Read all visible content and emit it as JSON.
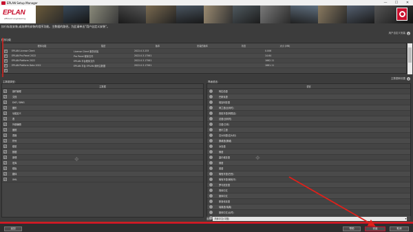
{
  "window": {
    "title": "EPLAN Setup Manager",
    "minimize": "—",
    "maximize": "☐",
    "close": "✕"
  },
  "banner": {
    "logo_text": "EPLAN",
    "logo_sub": "efficient engineering."
  },
  "instruction": "执行标准安装,或选择所安装的程序功能。主数据的路径。为此请单击\"用户自定义安装\"。",
  "custom_install_label": "用户自定义安装",
  "program_section": {
    "label": "程序功能",
    "columns": [
      "程序功能",
      "描述",
      "版本",
      "安装的版本",
      "状态",
      "大小 (MB)"
    ],
    "rows": [
      {
        "checked": true,
        "name": "EPLAN License Client",
        "desc": "License Client 服务安装",
        "version": "2022.0.3.233",
        "installed": "",
        "status": "",
        "size": "0.006"
      },
      {
        "checked": true,
        "name": "EPLAN Pro Panel 2022",
        "desc": "Pro Panel 程序文件",
        "version": "2022.0.3.17561",
        "installed": "",
        "status": "",
        "size": "14.64"
      },
      {
        "checked": true,
        "name": "EPLAN Platform 2022",
        "desc": "EPLAN 平台程序文件",
        "version": "2022.0.3.17561",
        "installed": "",
        "status": "",
        "size": "1662.11"
      },
      {
        "checked": true,
        "name": "EPLAN Platform Data 2022",
        "desc": "EPLAN 平台 EPLAN 用例主数据",
        "version": "2022.0.3.17561",
        "installed": "",
        "status": "",
        "size": "1661.11"
      },
      {
        "checked": true,
        "name": "",
        "desc": "",
        "version": "",
        "installed": "",
        "status": "",
        "size": ""
      }
    ]
  },
  "masterdata_expand_label": "主数据和设置",
  "master_data": {
    "caption": "主数据类型:",
    "column": "主数据",
    "items": [
      "部件管理",
      "文档",
      "DXF / DWG",
      "图形",
      "功能定义",
      "表",
      "外部编辑",
      "图框",
      "表格",
      "符号",
      "模型",
      "数据",
      "原理",
      "宏库",
      "模板",
      "翻译",
      "XML"
    ]
  },
  "interface_language": {
    "caption": "界面语言:",
    "column": "语言",
    "items": [
      "阿拉伯语",
      "巴斯克语",
      "保加利亚语",
      "荷兰语(比利时)",
      "西班牙语(阿根廷)",
      "法语(比利时)",
      "日语(日本)",
      "爱尔兰语",
      "意大利语(意大利)",
      "挪威语(挪威)",
      "冰岛语",
      "俄语",
      "塞尔维亚语",
      "德语",
      "英语",
      "葡萄牙语(巴西)",
      "葡萄牙语(葡萄牙)",
      "罗马尼亚语",
      "简体中文",
      "繁体中文",
      "斯洛伐克语",
      "瑞典语(瑞典)",
      "繁体中文(台湾)",
      "繁体中文(香港特别行政区)"
    ]
  },
  "language_selector": {
    "label": "语言:",
    "value": "简体中文(中国)"
  },
  "buttons": {
    "back": "返回",
    "help": "帮助",
    "install": "安装",
    "cancel": "取消"
  }
}
